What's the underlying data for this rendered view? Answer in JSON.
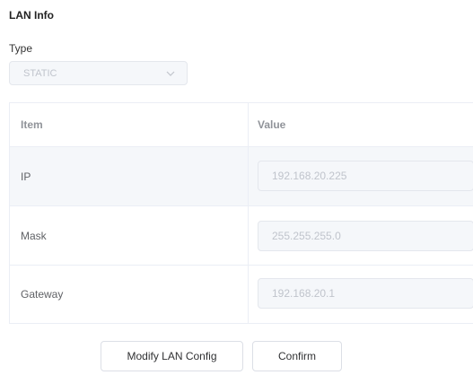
{
  "section": {
    "title": "LAN Info"
  },
  "type_field": {
    "label": "Type",
    "value": "STATIC",
    "icon": "chevron-down-icon"
  },
  "table": {
    "headers": {
      "item": "Item",
      "value": "Value"
    },
    "rows": [
      {
        "item": "IP",
        "value": "192.168.20.225"
      },
      {
        "item": "Mask",
        "value": "255.255.255.0"
      },
      {
        "item": "Gateway",
        "value": "192.168.20.1"
      }
    ]
  },
  "buttons": {
    "modify": "Modify LAN Config",
    "confirm": "Confirm"
  },
  "colors": {
    "disabled_bg": "#f5f7fa",
    "disabled_text": "#c0c4cc",
    "border": "#ebeef5"
  }
}
